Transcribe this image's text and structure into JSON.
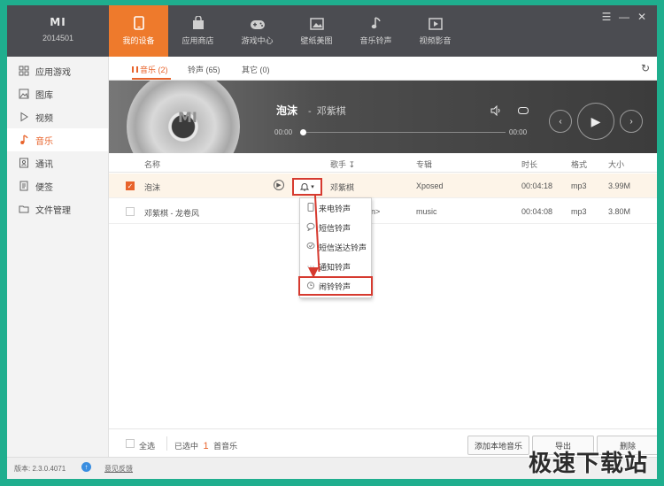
{
  "device": {
    "brand_mark": "MI",
    "name": "2014501"
  },
  "nav": {
    "tabs": [
      {
        "label": "我的设备",
        "icon": "phone-icon"
      },
      {
        "label": "应用商店",
        "icon": "bag-icon"
      },
      {
        "label": "游戏中心",
        "icon": "gamepad-icon"
      },
      {
        "label": "壁纸美图",
        "icon": "picture-icon"
      },
      {
        "label": "音乐铃声",
        "icon": "music-note-icon"
      },
      {
        "label": "视频影音",
        "icon": "video-icon"
      }
    ],
    "active": 0
  },
  "window": {
    "menu_glyph": "☰",
    "minimize_glyph": "—",
    "close_glyph": "✕"
  },
  "sidebar": {
    "items": [
      {
        "label": "应用游戏",
        "icon": "apps-icon"
      },
      {
        "label": "图库",
        "icon": "image-icon"
      },
      {
        "label": "视频",
        "icon": "play-icon"
      },
      {
        "label": "音乐",
        "icon": "music-icon"
      },
      {
        "label": "通讯",
        "icon": "contacts-icon"
      },
      {
        "label": "便签",
        "icon": "note-icon"
      },
      {
        "label": "文件管理",
        "icon": "folder-icon"
      }
    ],
    "active": 3
  },
  "subtabs": {
    "music": "音乐 (2)",
    "ringtone": "铃声 (65)",
    "other": "其它 (0)"
  },
  "player": {
    "disc_mark": "MI",
    "title": "泡沫",
    "separator": "-",
    "artist": "邓紫棋",
    "time_start": "00:00",
    "time_end": "00:00",
    "progress": 0
  },
  "table": {
    "headers": {
      "name": "名称",
      "artist": "歌手",
      "album": "专辑",
      "duration": "时长",
      "format": "格式",
      "size": "大小"
    },
    "rows": [
      {
        "name": "泡沫",
        "artist": "邓紫棋",
        "album": "Xposed",
        "duration": "00:04:18",
        "format": "mp3",
        "size": "3.99M",
        "checked": true
      },
      {
        "name": "邓紫棋 - 龙卷风",
        "artist": "n>",
        "album": "music",
        "duration": "00:04:08",
        "format": "mp3",
        "size": "3.80M",
        "checked": false
      }
    ]
  },
  "ring_menu": {
    "items": [
      {
        "label": "来电铃声",
        "icon": "phone-small-icon"
      },
      {
        "label": "短信铃声",
        "icon": "chat-bubble-icon"
      },
      {
        "label": "短信送达铃声",
        "icon": "chat-check-icon"
      },
      {
        "label": "通知铃声",
        "icon": "dots-icon"
      },
      {
        "label": "闹铃铃声",
        "icon": "alarm-clock-icon"
      }
    ],
    "highlighted": 4
  },
  "footer": {
    "select_all": "全选",
    "selected_prefix": "已选中",
    "selected_count": "1",
    "selected_suffix": "首音乐",
    "add_local": "添加本地音乐",
    "export": "导出",
    "delete": "删除"
  },
  "statusbar": {
    "version": "版本: 2.3.0.4071",
    "feedback": "意见反馈"
  },
  "watermark": "极速下载站",
  "colors": {
    "accent": "#ee7a2c",
    "annotation": "#d63a2f",
    "topbar": "#4b4c51"
  }
}
